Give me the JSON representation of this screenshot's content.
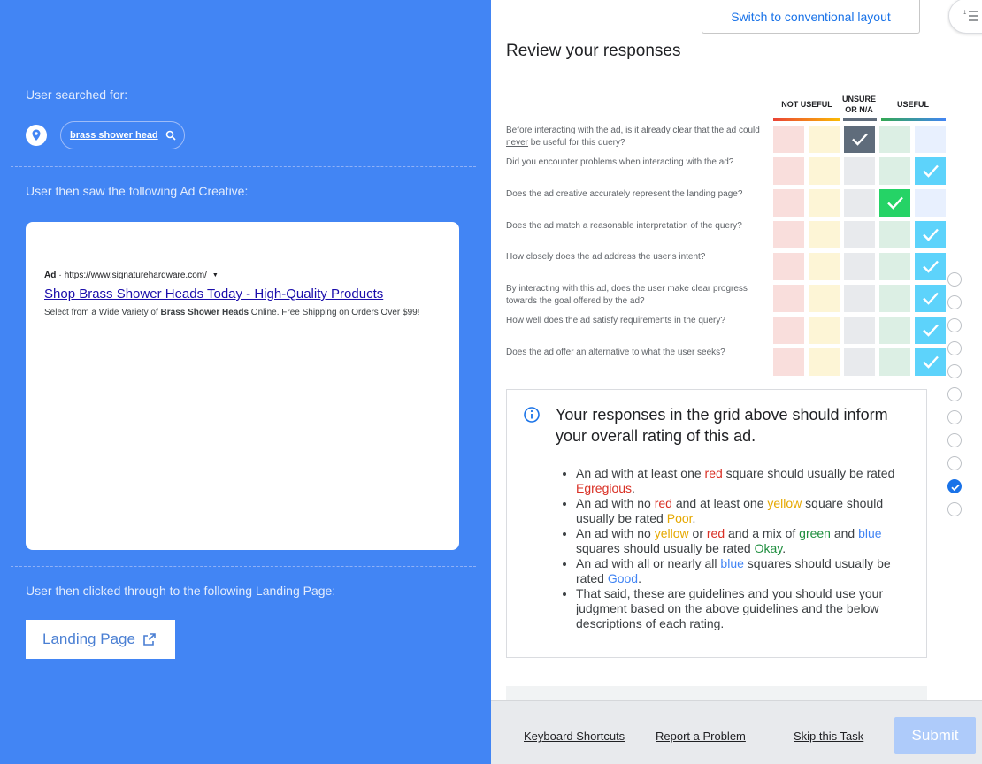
{
  "left": {
    "searched_label": "User searched for:",
    "query": "brass shower head",
    "creative_label": "User then saw the following Ad Creative:",
    "ad": {
      "badge": "Ad",
      "url": "https://www.signaturehardware.com/",
      "title": "Shop Brass Shower Heads Today - High-Quality Products",
      "desc_prefix": "Select from a Wide Variety of ",
      "desc_bold": "Brass Shower Heads",
      "desc_suffix": " Online. Free Shipping on Orders Over $99!"
    },
    "landing_label": "User then clicked through to the following Landing Page:",
    "landing_button": "Landing Page"
  },
  "right": {
    "switch_button": "Switch to conventional layout",
    "review_title": "Review your responses",
    "columns": {
      "not_useful": "NOT USEFUL",
      "unsure_l1": "UNSURE",
      "unsure_l2": "OR N/A",
      "useful": "USEFUL"
    },
    "questions": [
      {
        "pre": "Before interacting with the ad, is it already clear that the ad ",
        "u": "could never",
        "post": " be useful for this query?",
        "selected": 2
      },
      {
        "pre": "Did you encounter problems when interacting with the ad?",
        "u": "",
        "post": "",
        "selected": 4
      },
      {
        "pre": "Does the ad creative accurately represent the landing page?",
        "u": "",
        "post": "",
        "selected": 3
      },
      {
        "pre": "Does the ad match a reasonable interpretation of the query?",
        "u": "",
        "post": "",
        "selected": 4
      },
      {
        "pre": "How closely does the ad address the user's intent?",
        "u": "",
        "post": "",
        "selected": 4
      },
      {
        "pre": "By interacting with this ad, does the user make clear progress towards the goal offered by the ad?",
        "u": "",
        "post": "",
        "selected": 4
      },
      {
        "pre": "How well does the ad satisfy requirements in the query?",
        "u": "",
        "post": "",
        "selected": 4
      },
      {
        "pre": "Does the ad offer an alternative to what the user seeks?",
        "u": "",
        "post": "",
        "selected": 4
      }
    ],
    "info": {
      "title": "Your responses in the grid above should inform your overall rating of this ad.",
      "b1": {
        "a": "An ad with at least one ",
        "red": "red",
        "b": " square should usually be rated ",
        "rating": "Egregious",
        "c": "."
      },
      "b2": {
        "a": "An ad with no ",
        "red": "red",
        "b": " and at least one ",
        "yellow": "yellow",
        "c": " square should usually be rated ",
        "rating": "Poor",
        "d": "."
      },
      "b3": {
        "a": "An ad with no ",
        "yellow": "yellow",
        "b": " or ",
        "red": "red",
        "c": " and a mix of ",
        "green": "green",
        "d": " and ",
        "blue": "blue",
        "e": " squares should usually be rated ",
        "rating": "Okay",
        "f": "."
      },
      "b4": {
        "a": "An ad with all or nearly all ",
        "blue": "blue",
        "b": " squares should usually be rated ",
        "rating": "Good",
        "c": "."
      },
      "b5": "That said, these are guidelines and you should use your judgment based on the above guidelines and the below descriptions of each rating."
    },
    "radios_checked_index": 9
  },
  "footer": {
    "shortcuts": "Keyboard Shortcuts",
    "report": "Report a Problem",
    "skip": "Skip this Task",
    "submit": "Submit"
  },
  "colors": {
    "left_bg": "#4285f4",
    "red": "#d93025",
    "yellow": "#e6a800",
    "green": "#1e8e3e",
    "blue": "#4285f4"
  }
}
